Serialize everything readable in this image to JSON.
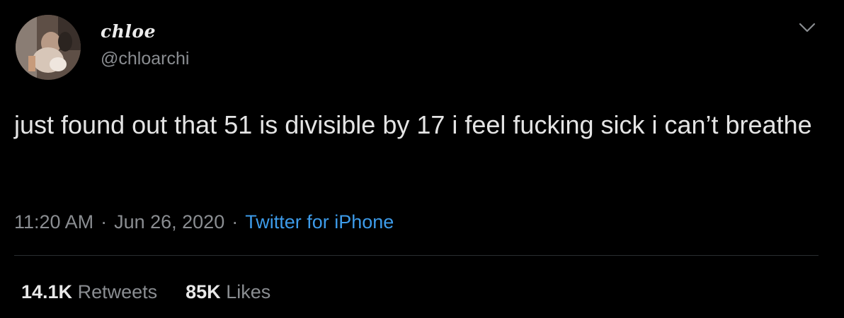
{
  "tweet": {
    "display_name": "chloe",
    "handle": "@chloarchi",
    "text": "just found out that 51 is divisible by 17 i feel fucking sick i can’t breathe",
    "time": "11:20 AM",
    "separator": "·",
    "date": "Jun 26, 2020",
    "source": "Twitter for iPhone",
    "retweets_count": "14.1K",
    "retweets_label": "Retweets",
    "likes_count": "85K",
    "likes_label": "Likes"
  },
  "icons": {
    "avatar": "profile-photo",
    "menu": "chevron-down-icon"
  },
  "colors": {
    "background": "#000000",
    "primary_text": "#e4e4e4",
    "secondary_text": "#8a8d91",
    "link": "#3d9be9",
    "divider": "#2a2d30"
  }
}
